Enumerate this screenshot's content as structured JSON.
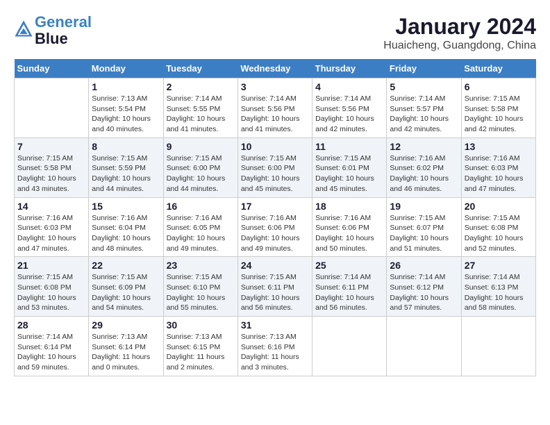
{
  "header": {
    "logo_line1": "General",
    "logo_line2": "Blue",
    "title": "January 2024",
    "subtitle": "Huaicheng, Guangdong, China"
  },
  "days_of_week": [
    "Sunday",
    "Monday",
    "Tuesday",
    "Wednesday",
    "Thursday",
    "Friday",
    "Saturday"
  ],
  "weeks": [
    [
      {
        "day": "",
        "info": ""
      },
      {
        "day": "1",
        "info": "Sunrise: 7:13 AM\nSunset: 5:54 PM\nDaylight: 10 hours\nand 40 minutes."
      },
      {
        "day": "2",
        "info": "Sunrise: 7:14 AM\nSunset: 5:55 PM\nDaylight: 10 hours\nand 41 minutes."
      },
      {
        "day": "3",
        "info": "Sunrise: 7:14 AM\nSunset: 5:56 PM\nDaylight: 10 hours\nand 41 minutes."
      },
      {
        "day": "4",
        "info": "Sunrise: 7:14 AM\nSunset: 5:56 PM\nDaylight: 10 hours\nand 42 minutes."
      },
      {
        "day": "5",
        "info": "Sunrise: 7:14 AM\nSunset: 5:57 PM\nDaylight: 10 hours\nand 42 minutes."
      },
      {
        "day": "6",
        "info": "Sunrise: 7:15 AM\nSunset: 5:58 PM\nDaylight: 10 hours\nand 42 minutes."
      }
    ],
    [
      {
        "day": "7",
        "info": "Sunrise: 7:15 AM\nSunset: 5:58 PM\nDaylight: 10 hours\nand 43 minutes."
      },
      {
        "day": "8",
        "info": "Sunrise: 7:15 AM\nSunset: 5:59 PM\nDaylight: 10 hours\nand 44 minutes."
      },
      {
        "day": "9",
        "info": "Sunrise: 7:15 AM\nSunset: 6:00 PM\nDaylight: 10 hours\nand 44 minutes."
      },
      {
        "day": "10",
        "info": "Sunrise: 7:15 AM\nSunset: 6:00 PM\nDaylight: 10 hours\nand 45 minutes."
      },
      {
        "day": "11",
        "info": "Sunrise: 7:15 AM\nSunset: 6:01 PM\nDaylight: 10 hours\nand 45 minutes."
      },
      {
        "day": "12",
        "info": "Sunrise: 7:16 AM\nSunset: 6:02 PM\nDaylight: 10 hours\nand 46 minutes."
      },
      {
        "day": "13",
        "info": "Sunrise: 7:16 AM\nSunset: 6:03 PM\nDaylight: 10 hours\nand 47 minutes."
      }
    ],
    [
      {
        "day": "14",
        "info": "Sunrise: 7:16 AM\nSunset: 6:03 PM\nDaylight: 10 hours\nand 47 minutes."
      },
      {
        "day": "15",
        "info": "Sunrise: 7:16 AM\nSunset: 6:04 PM\nDaylight: 10 hours\nand 48 minutes."
      },
      {
        "day": "16",
        "info": "Sunrise: 7:16 AM\nSunset: 6:05 PM\nDaylight: 10 hours\nand 49 minutes."
      },
      {
        "day": "17",
        "info": "Sunrise: 7:16 AM\nSunset: 6:06 PM\nDaylight: 10 hours\nand 49 minutes."
      },
      {
        "day": "18",
        "info": "Sunrise: 7:16 AM\nSunset: 6:06 PM\nDaylight: 10 hours\nand 50 minutes."
      },
      {
        "day": "19",
        "info": "Sunrise: 7:15 AM\nSunset: 6:07 PM\nDaylight: 10 hours\nand 51 minutes."
      },
      {
        "day": "20",
        "info": "Sunrise: 7:15 AM\nSunset: 6:08 PM\nDaylight: 10 hours\nand 52 minutes."
      }
    ],
    [
      {
        "day": "21",
        "info": "Sunrise: 7:15 AM\nSunset: 6:08 PM\nDaylight: 10 hours\nand 53 minutes."
      },
      {
        "day": "22",
        "info": "Sunrise: 7:15 AM\nSunset: 6:09 PM\nDaylight: 10 hours\nand 54 minutes."
      },
      {
        "day": "23",
        "info": "Sunrise: 7:15 AM\nSunset: 6:10 PM\nDaylight: 10 hours\nand 55 minutes."
      },
      {
        "day": "24",
        "info": "Sunrise: 7:15 AM\nSunset: 6:11 PM\nDaylight: 10 hours\nand 56 minutes."
      },
      {
        "day": "25",
        "info": "Sunrise: 7:14 AM\nSunset: 6:11 PM\nDaylight: 10 hours\nand 56 minutes."
      },
      {
        "day": "26",
        "info": "Sunrise: 7:14 AM\nSunset: 6:12 PM\nDaylight: 10 hours\nand 57 minutes."
      },
      {
        "day": "27",
        "info": "Sunrise: 7:14 AM\nSunset: 6:13 PM\nDaylight: 10 hours\nand 58 minutes."
      }
    ],
    [
      {
        "day": "28",
        "info": "Sunrise: 7:14 AM\nSunset: 6:14 PM\nDaylight: 10 hours\nand 59 minutes."
      },
      {
        "day": "29",
        "info": "Sunrise: 7:13 AM\nSunset: 6:14 PM\nDaylight: 11 hours\nand 0 minutes."
      },
      {
        "day": "30",
        "info": "Sunrise: 7:13 AM\nSunset: 6:15 PM\nDaylight: 11 hours\nand 2 minutes."
      },
      {
        "day": "31",
        "info": "Sunrise: 7:13 AM\nSunset: 6:16 PM\nDaylight: 11 hours\nand 3 minutes."
      },
      {
        "day": "",
        "info": ""
      },
      {
        "day": "",
        "info": ""
      },
      {
        "day": "",
        "info": ""
      }
    ]
  ]
}
